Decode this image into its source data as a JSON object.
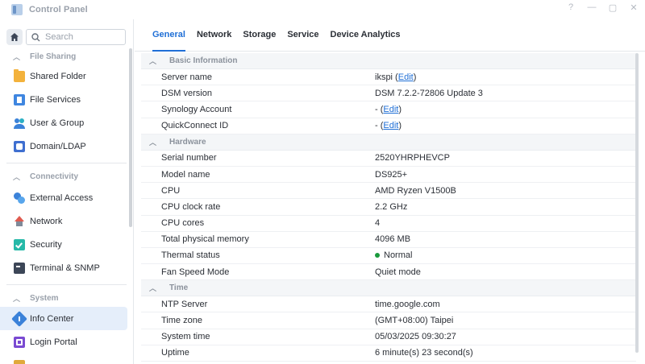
{
  "window": {
    "title": "Control Panel",
    "controls": [
      "?",
      "—",
      "▢",
      "✕"
    ]
  },
  "sidebar": {
    "search_placeholder": "Search",
    "sections": [
      {
        "label": "File Sharing",
        "items": [
          {
            "label": "Shared Folder"
          },
          {
            "label": "File Services"
          },
          {
            "label": "User & Group"
          },
          {
            "label": "Domain/LDAP"
          }
        ]
      },
      {
        "label": "Connectivity",
        "items": [
          {
            "label": "External Access"
          },
          {
            "label": "Network"
          },
          {
            "label": "Security"
          },
          {
            "label": "Terminal & SNMP"
          }
        ]
      },
      {
        "label": "System",
        "items": [
          {
            "label": "Info Center",
            "active": true
          },
          {
            "label": "Login Portal"
          }
        ]
      }
    ]
  },
  "tabs": [
    {
      "label": "General",
      "active": true
    },
    {
      "label": "Network"
    },
    {
      "label": "Storage"
    },
    {
      "label": "Service"
    },
    {
      "label": "Device Analytics"
    }
  ],
  "groups": {
    "basic": {
      "label": "Basic Information",
      "rows": [
        {
          "key": "Server name",
          "value": "ikspi (",
          "link": "Edit",
          "suffix": ")"
        },
        {
          "key": "DSM version",
          "value": "DSM 7.2.2-72806 Update 3"
        },
        {
          "key": "Synology Account",
          "value": "- (",
          "link": "Edit",
          "suffix": ")"
        },
        {
          "key": "QuickConnect ID",
          "value": "- (",
          "link": "Edit",
          "suffix": ")"
        }
      ]
    },
    "hardware": {
      "label": "Hardware",
      "rows": [
        {
          "key": "Serial number",
          "value": "2520YHRPHEVCP"
        },
        {
          "key": "Model name",
          "value": "DS925+"
        },
        {
          "key": "CPU",
          "value": "AMD Ryzen V1500B"
        },
        {
          "key": "CPU clock rate",
          "value": "2.2 GHz"
        },
        {
          "key": "CPU cores",
          "value": "4"
        },
        {
          "key": "Total physical memory",
          "value": "4096 MB"
        },
        {
          "key": "Thermal status",
          "value": "Normal"
        },
        {
          "key": "Fan Speed Mode",
          "value": "Quiet mode"
        }
      ]
    },
    "time": {
      "label": "Time",
      "rows": [
        {
          "key": "NTP Server",
          "value": "time.google.com"
        },
        {
          "key": "Time zone",
          "value": "(GMT+08:00) Taipei"
        },
        {
          "key": "System time",
          "value": "05/03/2025 09:30:27"
        },
        {
          "key": "Uptime",
          "value": "6 minute(s) 23 second(s)"
        }
      ]
    }
  },
  "colors": {
    "accent": "#1f6fd6",
    "status_ok": "#1a9a3c"
  }
}
